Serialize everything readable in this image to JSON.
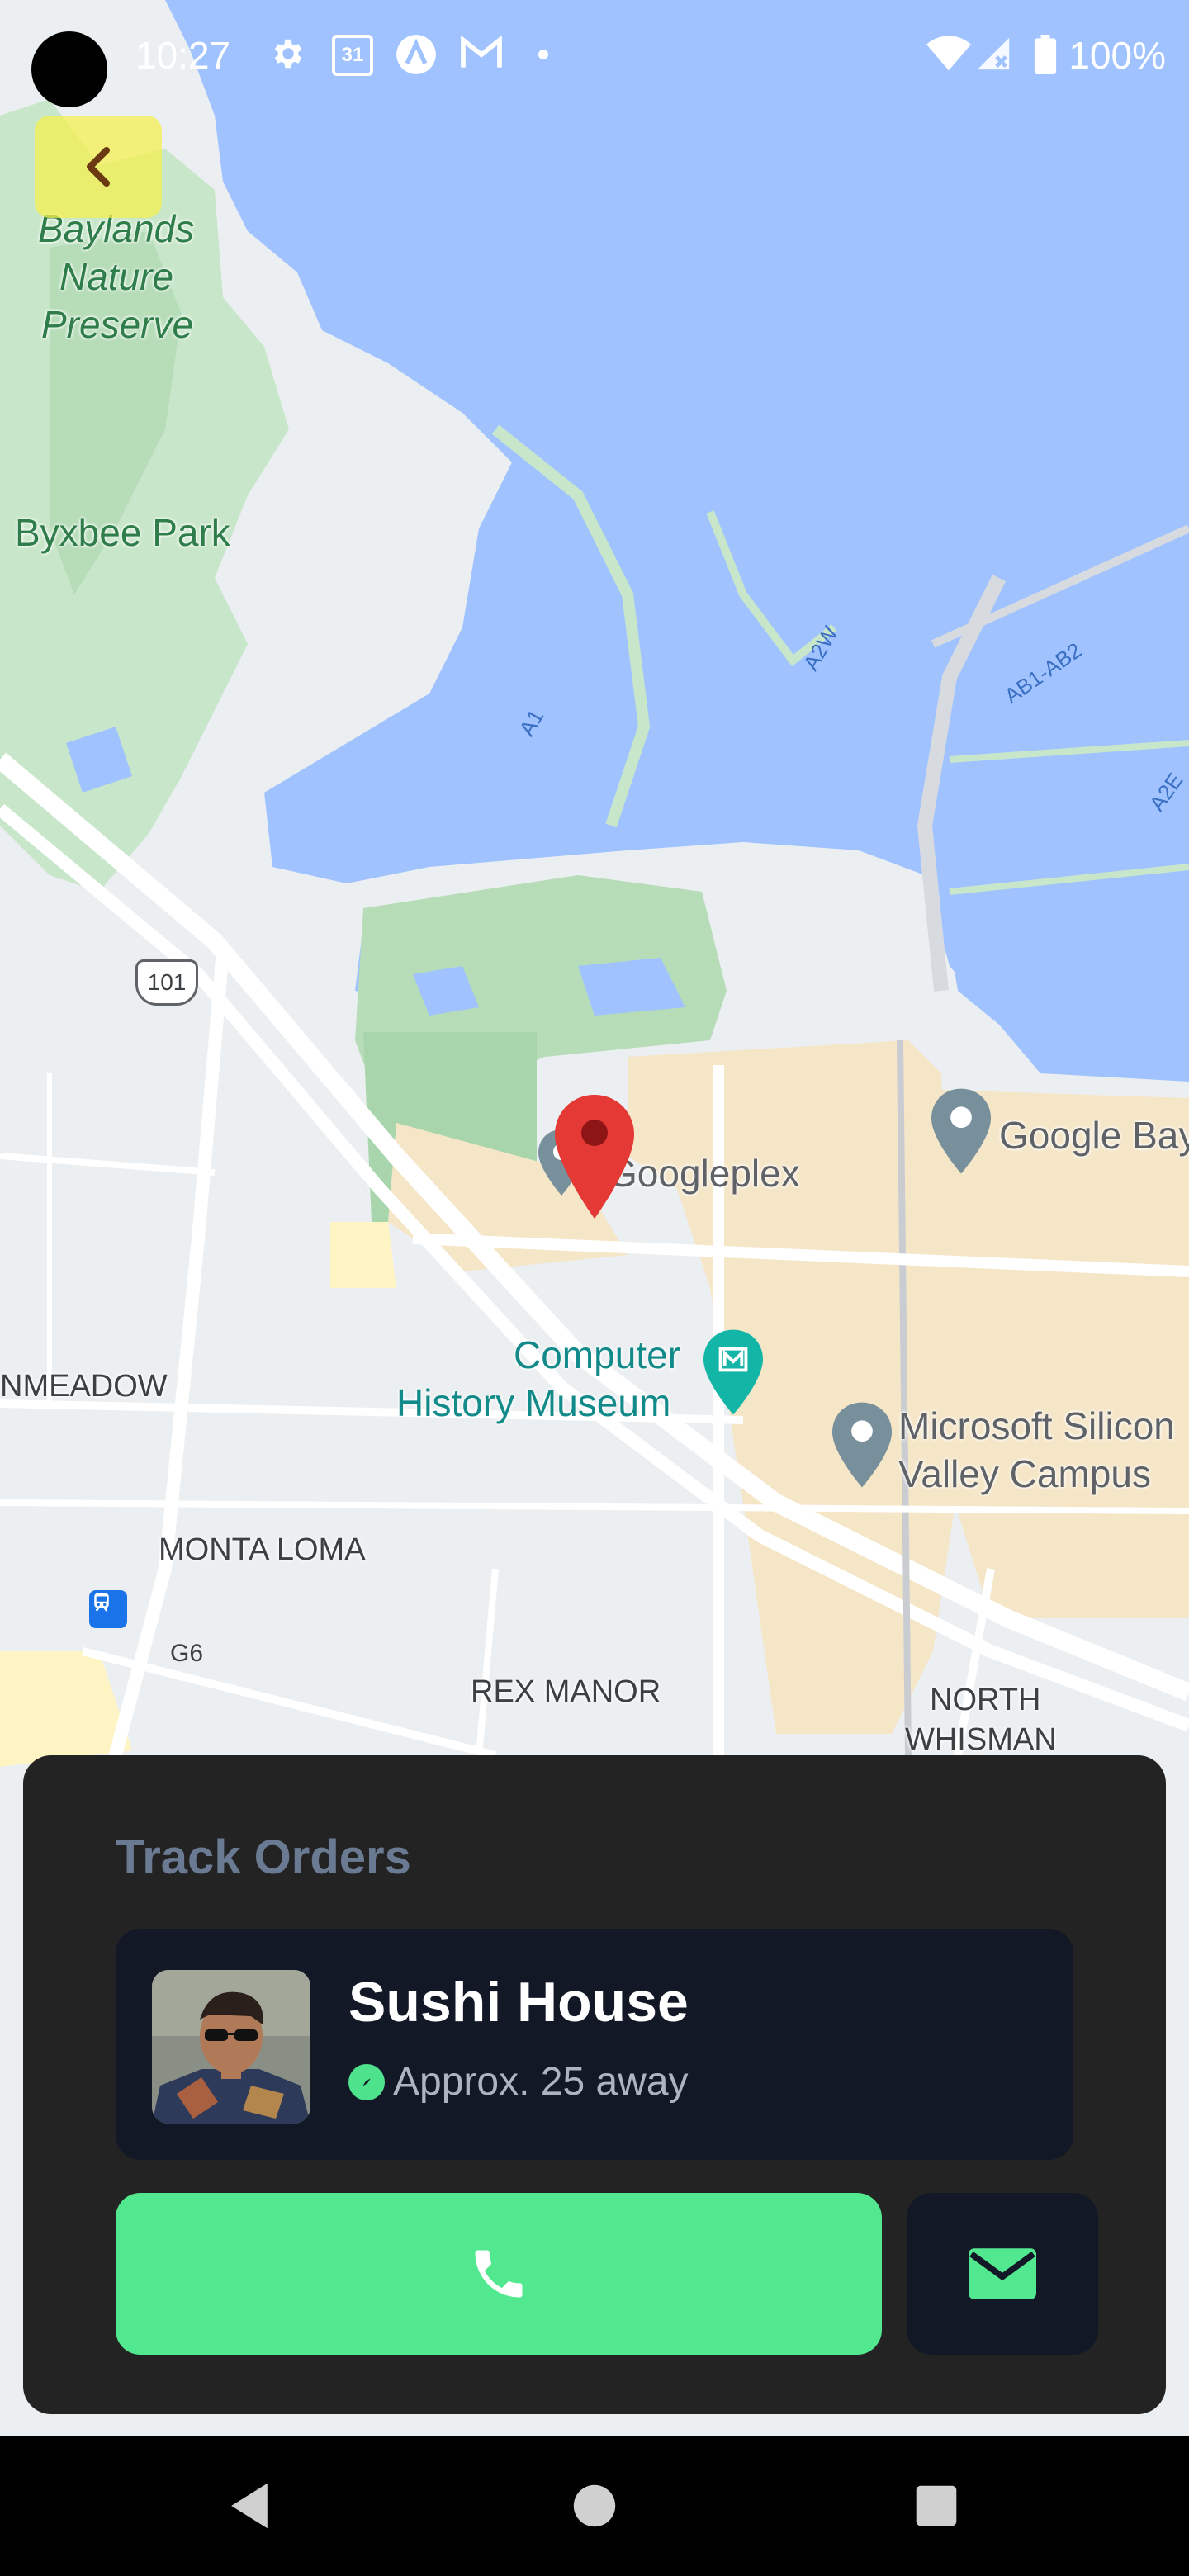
{
  "status_bar": {
    "time": "10:27",
    "battery": "100%",
    "icons": [
      "settings-icon",
      "calendar-icon",
      "arc-icon",
      "gmail-icon",
      "dot-icon",
      "wifi-icon",
      "signal-icon",
      "battery-icon"
    ],
    "calendar_day": "31"
  },
  "map": {
    "labels": {
      "baylands_1": "Baylands",
      "baylands_2": "Nature",
      "baylands_3": "Preserve",
      "byxbee": "Byxbee Park",
      "googleplex": "Googleplex",
      "google_bay": "Google Bay",
      "computer_1": "Computer",
      "computer_2": "History Museum",
      "microsoft_1": "Microsoft Silicon",
      "microsoft_2": "Valley Campus",
      "meadow": "NMEADOW",
      "monta_loma": "MONTA LOMA",
      "rex_manor": "REX MANOR",
      "north_1": "NORTH",
      "north_2": "WHISMAN",
      "route_101": "101",
      "g6": "G6",
      "a1": "A1",
      "a2w": "A2W",
      "ab1ab2": "AB1-AB2",
      "a2e": "A2E"
    }
  },
  "card": {
    "title": "Track Orders",
    "restaurant_name": "Sushi House",
    "eta": "Approx. 25 away"
  },
  "colors": {
    "accent_green": "#52e88f",
    "card_bg": "#232323",
    "panel_bg": "#121826",
    "title_color": "#6b7a93",
    "marker_red": "#e53935"
  }
}
